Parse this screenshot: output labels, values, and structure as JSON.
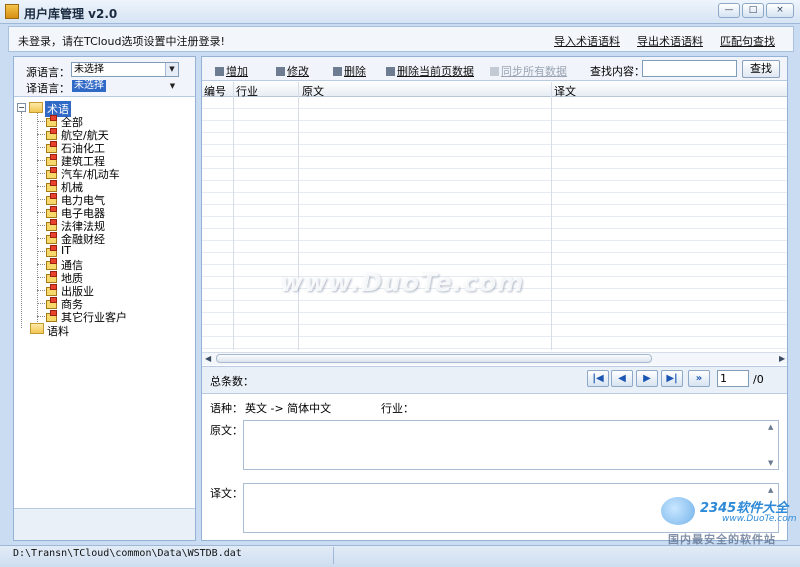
{
  "window": {
    "title": "用户库管理 v2.0",
    "controls": {
      "minimize": "—",
      "maximize": "□",
      "close": "×"
    }
  },
  "topbar": {
    "login_message": "未登录，请在TCloud选项设置中注册登录!",
    "links": [
      "导入术语语料",
      "导出术语语料",
      "匹配句查找"
    ]
  },
  "language": {
    "source_label": "源语言：",
    "source_value": "未选择",
    "target_label": "译语言：",
    "target_value": "未选择"
  },
  "tree": {
    "root": "术语",
    "children": [
      "全部",
      "航空/航天",
      "石油化工",
      "建筑工程",
      "汽车/机动车",
      "机械",
      "电力电气",
      "电子电器",
      "法律法规",
      "金融财经",
      "IT",
      "通信",
      "地质",
      "出版业",
      "商务",
      "其它行业客户"
    ],
    "corpus": "语料"
  },
  "toolbar": {
    "add": "增加",
    "edit": "修改",
    "delete": "删除",
    "delete_page": "删除当前页数据",
    "sync": "同步所有数据",
    "search_label": "查找内容：",
    "search_value": "",
    "search_button": "查找"
  },
  "grid": {
    "columns": [
      "编号",
      "行业",
      "原文",
      "译文"
    ],
    "rows": []
  },
  "pager": {
    "total_label": "总条数：",
    "total_value": "",
    "current_page": "1",
    "total_pages": "/0"
  },
  "detail": {
    "lang_label": "语种：",
    "lang_value": "英文 -> 简体中文",
    "industry_label": "行业：",
    "source_label": "原文：",
    "target_label": "译文："
  },
  "status": {
    "path": "D:\\Transn\\TCloud\\common\\Data\\WSTDB.dat"
  },
  "watermark": {
    "duote": "www.DuoTe.com",
    "brand": "2345软件大全",
    "url": "www.DuoTe.com",
    "slogan": "国内最安全的软件站"
  },
  "colors": {
    "accent": "#3169c6",
    "frame": "#c9dcf1",
    "border": "#94b1d6"
  }
}
